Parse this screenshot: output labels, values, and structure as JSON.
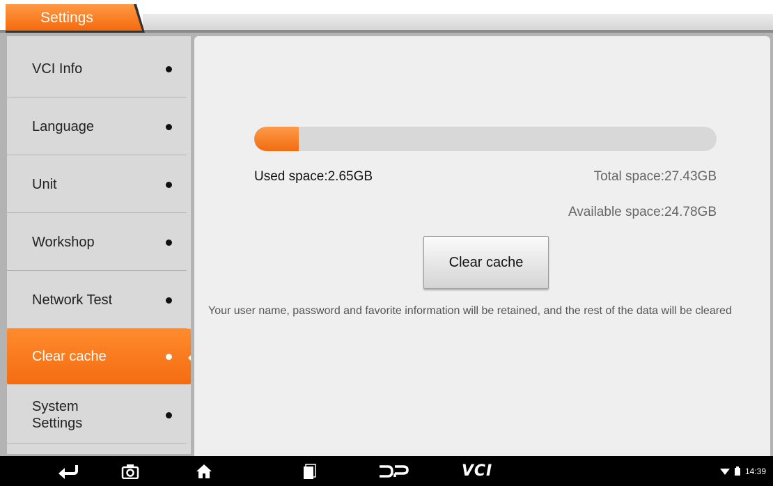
{
  "header": {
    "title": "Settings"
  },
  "sidebar": {
    "items": [
      {
        "label": "VCI Info",
        "active": false
      },
      {
        "label": "Language",
        "active": false
      },
      {
        "label": "Unit",
        "active": false
      },
      {
        "label": "Workshop",
        "active": false
      },
      {
        "label": "Network Test",
        "active": false
      },
      {
        "label": "Clear cache",
        "active": true
      },
      {
        "label": "System\nSettings",
        "active": false
      }
    ]
  },
  "storage": {
    "used_label": "Used space:2.65GB",
    "total_label": "Total space:27.43GB",
    "available_label": "Available space:24.78GB",
    "used_fraction": 0.0966
  },
  "actions": {
    "clear_cache_label": "Clear cache"
  },
  "note": "Your user name, password and favorite information will be retained, and the rest of the data will be cleared",
  "statusbar": {
    "time": "14:39"
  },
  "navbar": {
    "vci_label": "VCI",
    "icons": [
      "back-icon",
      "camera-icon",
      "home-icon",
      "recent-apps-icon",
      "dp-logo-icon",
      "vci-icon"
    ]
  },
  "colors": {
    "accent": "#f47a1f",
    "frame": "#b3b3b3",
    "panel": "#efefef"
  }
}
